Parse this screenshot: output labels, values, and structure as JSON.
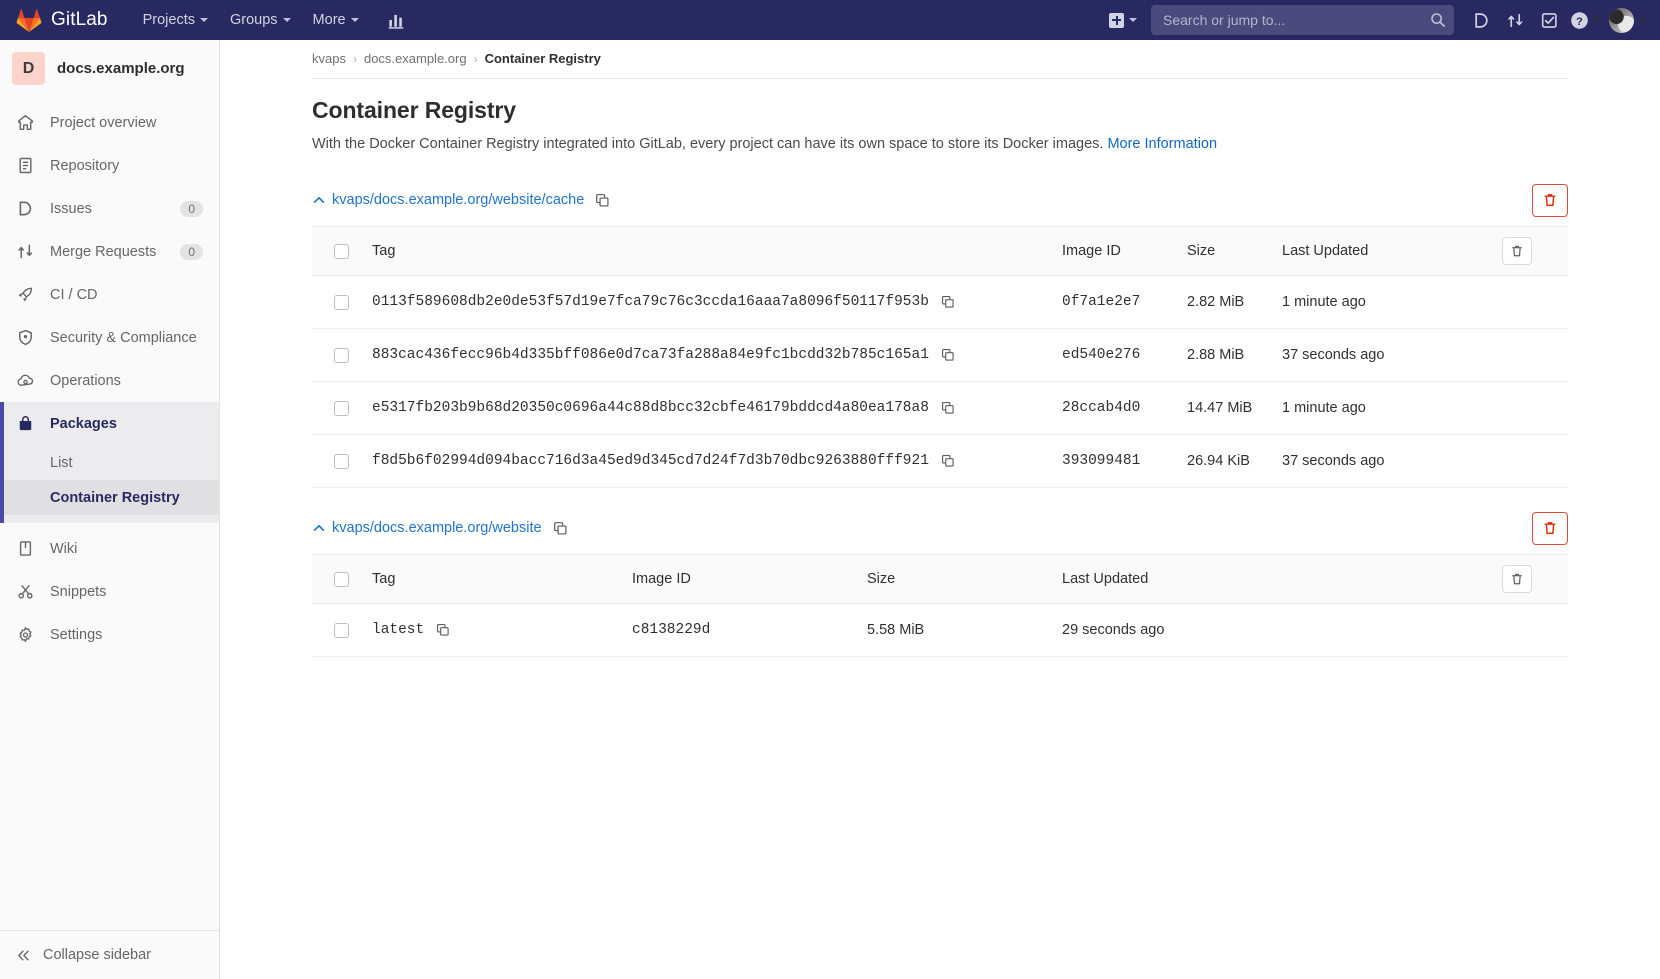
{
  "navbar": {
    "brand": "GitLab",
    "items": [
      {
        "label": "Projects",
        "name": "nav-projects"
      },
      {
        "label": "Groups",
        "name": "nav-groups"
      },
      {
        "label": "More",
        "name": "nav-more"
      }
    ],
    "analytics_icon": "chart-bar-icon",
    "create_new_icon": "plus-square-icon",
    "search": {
      "placeholder": "Search or jump to...",
      "value": "",
      "icon": "search-icon"
    },
    "right_icons": [
      {
        "name": "issues-icon",
        "title": "Issues"
      },
      {
        "name": "merge-requests-icon",
        "title": "Merge requests"
      },
      {
        "name": "todos-icon",
        "title": "To-Do List"
      }
    ],
    "help_icon": "question-circle-icon",
    "avatar": "user-avatar"
  },
  "sidebar": {
    "project": {
      "initial": "D",
      "name": "docs.example.org"
    },
    "items": [
      {
        "label": "Project overview",
        "icon": "home-icon",
        "badge": null,
        "active": false
      },
      {
        "label": "Repository",
        "icon": "document-icon",
        "badge": null,
        "active": false
      },
      {
        "label": "Issues",
        "icon": "issues-icon",
        "badge": "0",
        "active": false
      },
      {
        "label": "Merge Requests",
        "icon": "merge-icon",
        "badge": "0",
        "active": false
      },
      {
        "label": "CI / CD",
        "icon": "rocket-icon",
        "badge": null,
        "active": false
      },
      {
        "label": "Security & Compliance",
        "icon": "shield-icon",
        "badge": null,
        "active": false
      },
      {
        "label": "Operations",
        "icon": "cloud-gear-icon",
        "badge": null,
        "active": false
      },
      {
        "label": "Packages",
        "icon": "package-icon",
        "badge": null,
        "active": true
      }
    ],
    "packages_sub": [
      {
        "label": "List",
        "active": false
      },
      {
        "label": "Container Registry",
        "active": true
      }
    ],
    "items_after": [
      {
        "label": "Wiki",
        "icon": "book-icon",
        "badge": null,
        "active": false
      },
      {
        "label": "Snippets",
        "icon": "scissors-icon",
        "badge": null,
        "active": false
      },
      {
        "label": "Settings",
        "icon": "gear-icon",
        "badge": null,
        "active": false
      }
    ],
    "collapse": {
      "label": "Collapse sidebar",
      "icon": "chevron-double-left-icon"
    }
  },
  "breadcrumb": {
    "items": [
      {
        "label": "kvaps",
        "current": false
      },
      {
        "label": "docs.example.org",
        "current": false
      },
      {
        "label": "Container Registry",
        "current": true
      }
    ],
    "separator": "›"
  },
  "page": {
    "title": "Container Registry",
    "description_before": "With the Docker Container Registry integrated into GitLab, every project can have its own space to store its Docker images. ",
    "description_link": "More Information"
  },
  "columns": {
    "tag": "Tag",
    "image_id": "Image ID",
    "size": "Size",
    "last_updated": "Last Updated"
  },
  "icons": {
    "expand_chevron": "chevron-up-icon",
    "copy": "copy-icon",
    "trash": "trash-icon"
  },
  "repositories": [
    {
      "path": "kvaps/docs.example.org/website/cache",
      "layout": "wide",
      "tags": [
        {
          "tag": "0113f589608db2e0de53f57d19e7fca79c76c3ccda16aaa7a8096f50117f953b",
          "image_id": "0f7a1e2e7",
          "size": "2.82 MiB",
          "last_updated": "1 minute ago"
        },
        {
          "tag": "883cac436fecc96b4d335bff086e0d7ca73fa288a84e9fc1bcdd32b785c165a1",
          "image_id": "ed540e276",
          "size": "2.88 MiB",
          "last_updated": "37 seconds ago"
        },
        {
          "tag": "e5317fb203b9b68d20350c0696a44c88d8bcc32cbfe46179bddcd4a80ea178a8",
          "image_id": "28ccab4d0",
          "size": "14.47 MiB",
          "last_updated": "1 minute ago"
        },
        {
          "tag": "f8d5b6f02994d094bacc716d3a45ed9d345cd7d24f7d3b70dbc9263880fff921",
          "image_id": "393099481",
          "size": "26.94 KiB",
          "last_updated": "37 seconds ago"
        }
      ]
    },
    {
      "path": "kvaps/docs.example.org/website",
      "layout": "narrow",
      "tags": [
        {
          "tag": "latest",
          "image_id": "c8138229d",
          "size": "5.58 MiB",
          "last_updated": "29 seconds ago"
        }
      ]
    }
  ]
}
